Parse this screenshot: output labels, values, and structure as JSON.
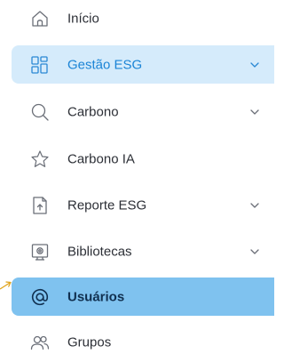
{
  "colors": {
    "expanded_bg": "#d5ebfb",
    "expanded_text": "#1b84d6",
    "active_bg": "#7fc2ef",
    "active_text": "#113050",
    "text": "#2c2f36",
    "icon": "#6b6f78",
    "pointer": "#e0a31a"
  },
  "sidebar": {
    "items": [
      {
        "label": "Início",
        "icon": "home-icon",
        "has_submenu": false
      },
      {
        "label": "Gestão ESG",
        "icon": "grid-icon",
        "has_submenu": true,
        "state": "expanded"
      },
      {
        "label": "Carbono",
        "icon": "search-icon",
        "has_submenu": true
      },
      {
        "label": "Carbono IA",
        "icon": "star-icon",
        "has_submenu": false
      },
      {
        "label": "Reporte ESG",
        "icon": "document-upload-icon",
        "has_submenu": true
      },
      {
        "label": "Bibliotecas",
        "icon": "library-icon",
        "has_submenu": true
      },
      {
        "label": "Usuários",
        "icon": "at-sign-icon",
        "has_submenu": false,
        "state": "active"
      },
      {
        "label": "Grupos",
        "icon": "users-icon",
        "has_submenu": false
      }
    ]
  }
}
